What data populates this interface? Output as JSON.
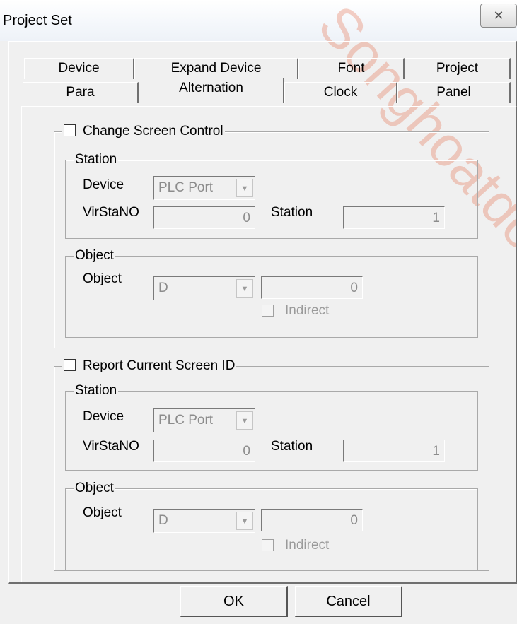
{
  "window": {
    "title": "Project Set",
    "close_icon": "close-icon"
  },
  "watermark": "Songhoatdo",
  "tabs_row1": [
    {
      "label": "Device"
    },
    {
      "label": "Expand Device"
    },
    {
      "label": "Font"
    },
    {
      "label": "Project"
    }
  ],
  "tabs_row2": [
    {
      "label": "Para"
    },
    {
      "label": "Alternation",
      "active": true
    },
    {
      "label": "Clock"
    },
    {
      "label": "Panel"
    }
  ],
  "section1": {
    "checkbox_label": "Change Screen Control",
    "station": {
      "legend": "Station",
      "device_label": "Device",
      "device_value": "PLC Port",
      "virstano_label": "VirStaNO",
      "virstano_value": "0",
      "station_label": "Station",
      "station_value": "1"
    },
    "object": {
      "legend": "Object",
      "object_label": "Object",
      "object_type": "D",
      "object_value": "0",
      "indirect_label": "Indirect"
    }
  },
  "section2": {
    "checkbox_label": "Report Current Screen ID",
    "station": {
      "legend": "Station",
      "device_label": "Device",
      "device_value": "PLC Port",
      "virstano_label": "VirStaNO",
      "virstano_value": "0",
      "station_label": "Station",
      "station_value": "1"
    },
    "object": {
      "legend": "Object",
      "object_label": "Object",
      "object_type": "D",
      "object_value": "0",
      "indirect_label": "Indirect"
    }
  },
  "buttons": {
    "ok": "OK",
    "cancel": "Cancel"
  }
}
